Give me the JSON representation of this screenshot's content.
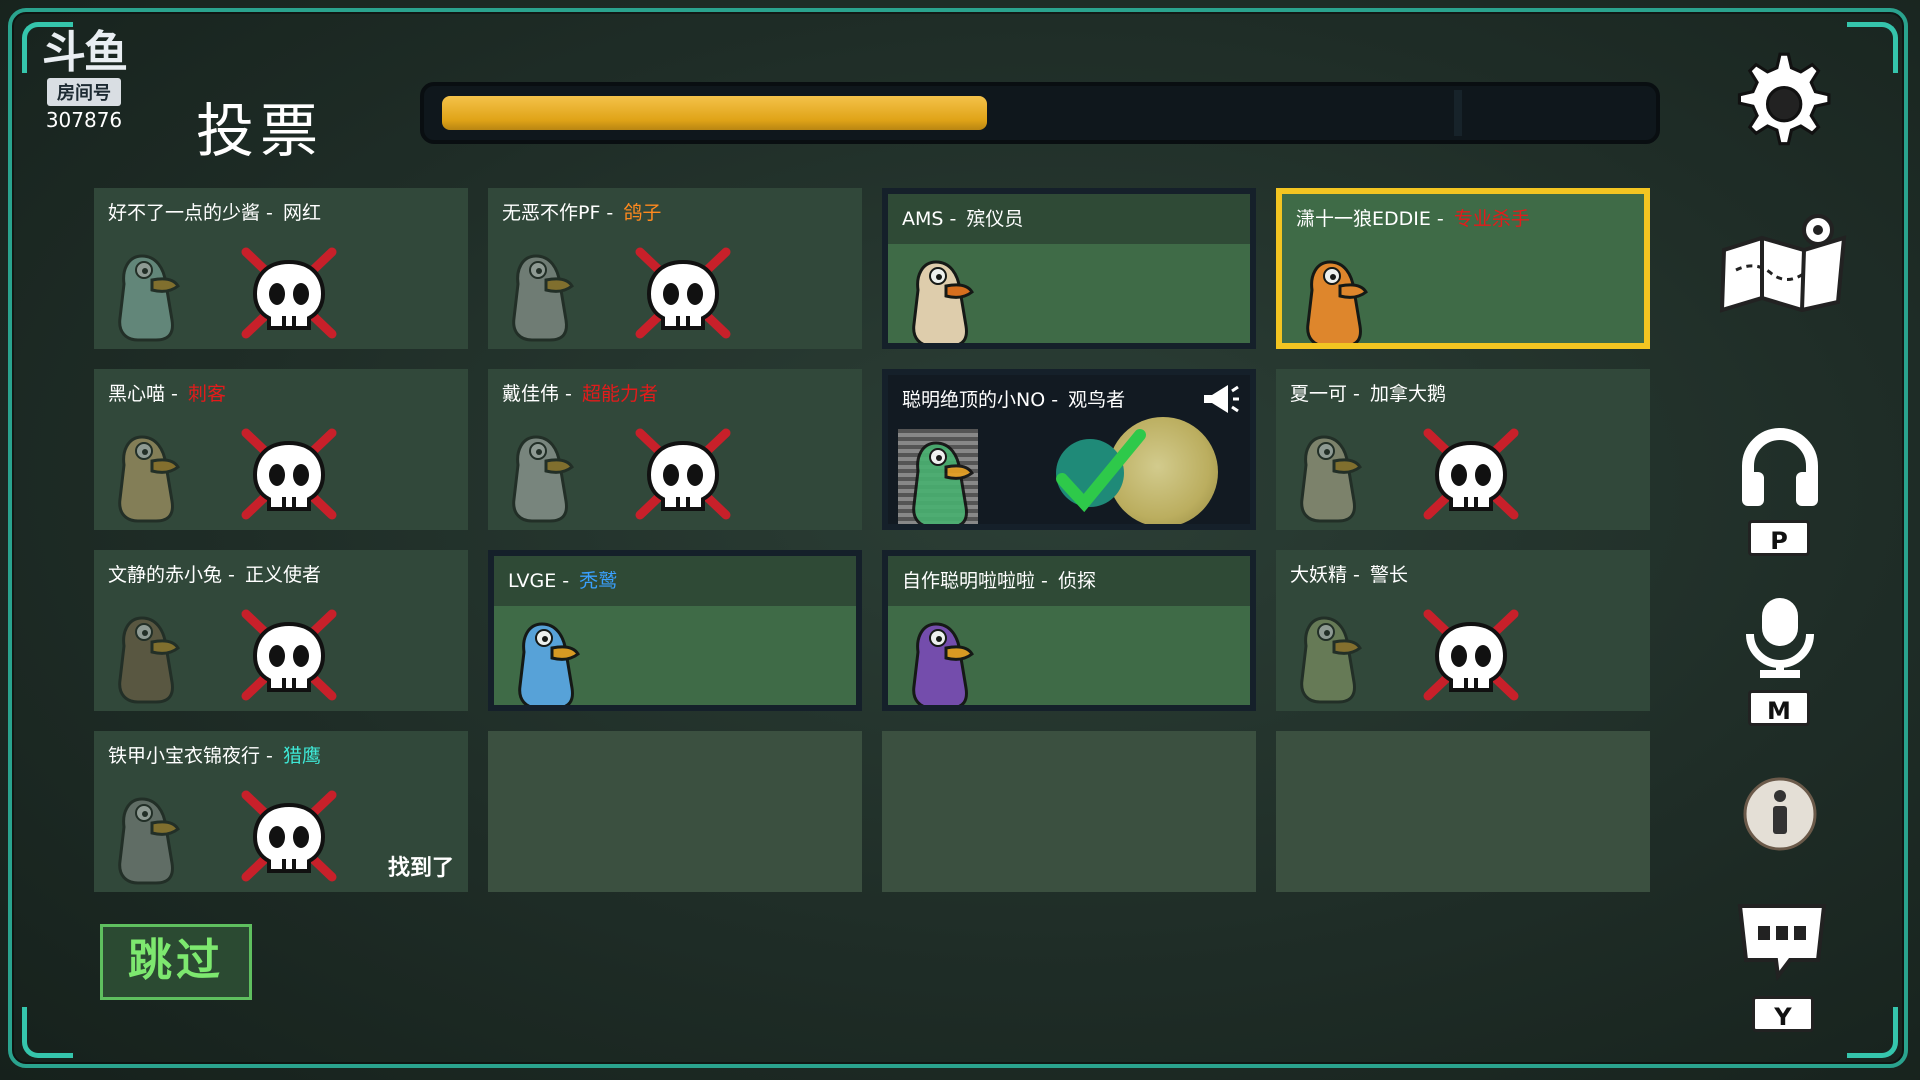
{
  "logo": {
    "text": "斗鱼",
    "room_label": "房间号",
    "room_number": "307876"
  },
  "title": "投票",
  "progress": {
    "fraction": 0.45
  },
  "players": [
    {
      "name": "好不了一点的少酱",
      "role": "网红",
      "role_color": "#ffffff",
      "state": "dead"
    },
    {
      "name": "无恶不作PF",
      "role": "鸽子",
      "role_color": "#ff8a1e",
      "state": "dead"
    },
    {
      "name": "AMS",
      "role": "殡仪员",
      "role_color": "#ffffff",
      "state": "alive"
    },
    {
      "name": "潇十一狼EDDIE",
      "role": "专业杀手",
      "role_color": "#e31b1b",
      "state": "selected"
    },
    {
      "name": "黑心喵",
      "role": "刺客",
      "role_color": "#e31b1b",
      "state": "dead"
    },
    {
      "name": "戴佳伟",
      "role": "超能力者",
      "role_color": "#e31b1b",
      "state": "dead"
    },
    {
      "name": "聪明绝顶的小NO",
      "role": "观鸟者",
      "role_color": "#ffffff",
      "state": "speaking"
    },
    {
      "name": "夏一可",
      "role": "加拿大鹅",
      "role_color": "#ffffff",
      "state": "dead"
    },
    {
      "name": "文静的赤小兔",
      "role": "正义使者",
      "role_color": "#ffffff",
      "state": "dead"
    },
    {
      "name": "LVGE",
      "role": "秃鹫",
      "role_color": "#3aa0ff",
      "state": "alive"
    },
    {
      "name": "自作聪明啦啦啦",
      "role": "侦探",
      "role_color": "#ffffff",
      "state": "alive"
    },
    {
      "name": "大妖精",
      "role": "警长",
      "role_color": "#ffffff",
      "state": "dead"
    },
    {
      "name": "铁甲小宝衣锦夜行",
      "role": "猎鹰",
      "role_color": "#3ee8d6",
      "state": "dead",
      "badge": "找到了"
    }
  ],
  "skip_label": "跳过",
  "side": {
    "settings_icon": "gear-icon",
    "map_icon": "map-icon",
    "headphone_key": "P",
    "mic_key": "M",
    "info_icon": "info-icon",
    "chat_key": "Y"
  },
  "colors": {
    "accent": "#2aa38e",
    "progress": "#e9b12a",
    "selected_border": "#f3c521"
  }
}
